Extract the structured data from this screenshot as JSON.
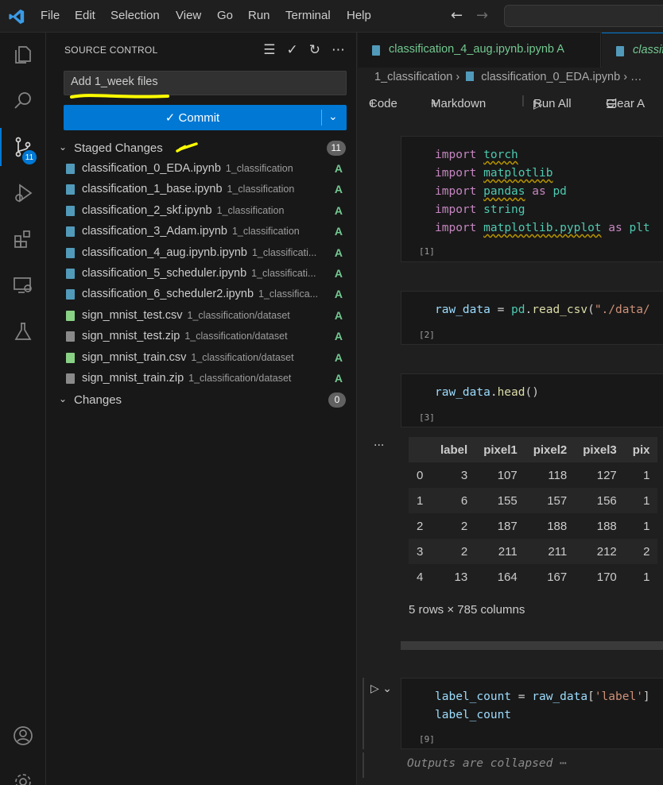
{
  "menu": [
    "File",
    "Edit",
    "Selection",
    "View",
    "Go",
    "Run",
    "Terminal",
    "Help"
  ],
  "activity": {
    "badge": "11"
  },
  "sidebar": {
    "title": "SOURCE CONTROL",
    "commit_message": "Add 1_week files",
    "commit_label": "Commit",
    "staged": {
      "title": "Staged Changes",
      "count": "11"
    },
    "changes": {
      "title": "Changes",
      "count": "0"
    },
    "files": [
      {
        "name": "classification_0_EDA.ipynb",
        "dir": "1_classification",
        "status": "A",
        "kind": "notebook"
      },
      {
        "name": "classification_1_base.ipynb",
        "dir": "1_classification",
        "status": "A",
        "kind": "notebook"
      },
      {
        "name": "classification_2_skf.ipynb",
        "dir": "1_classification",
        "status": "A",
        "kind": "notebook"
      },
      {
        "name": "classification_3_Adam.ipynb",
        "dir": "1_classification",
        "status": "A",
        "kind": "notebook"
      },
      {
        "name": "classification_4_aug.ipynb.ipynb",
        "dir": "1_classificati...",
        "status": "A",
        "kind": "notebook"
      },
      {
        "name": "classification_5_scheduler.ipynb",
        "dir": "1_classificati...",
        "status": "A",
        "kind": "notebook"
      },
      {
        "name": "classification_6_scheduler2.ipynb",
        "dir": "1_classifica...",
        "status": "A",
        "kind": "notebook"
      },
      {
        "name": "sign_mnist_test.csv",
        "dir": "1_classification/dataset",
        "status": "A",
        "kind": "csv"
      },
      {
        "name": "sign_mnist_test.zip",
        "dir": "1_classification/dataset",
        "status": "A",
        "kind": "zip"
      },
      {
        "name": "sign_mnist_train.csv",
        "dir": "1_classification/dataset",
        "status": "A",
        "kind": "csv"
      },
      {
        "name": "sign_mnist_train.zip",
        "dir": "1_classification/dataset",
        "status": "A",
        "kind": "zip"
      }
    ]
  },
  "editor": {
    "tabs": [
      {
        "label": "classification_4_aug.ipynb.ipynb",
        "status": "A"
      },
      {
        "label": "classifi"
      }
    ],
    "breadcrumb": {
      "folder": "1_classification",
      "file": "classification_0_EDA.ipynb"
    },
    "toolbar": {
      "code": "Code",
      "markdown": "Markdown",
      "run_all": "Run All",
      "clear": "Clear A"
    },
    "cells": [
      {
        "exec": "[1]"
      },
      {
        "exec": "[2]"
      },
      {
        "exec": "[3]"
      },
      {
        "exec": "[9]"
      }
    ],
    "dataframe": {
      "columns": [
        "",
        "label",
        "pixel1",
        "pixel2",
        "pixel3",
        "pix"
      ],
      "rows": [
        [
          "0",
          "3",
          "107",
          "118",
          "127",
          "1"
        ],
        [
          "1",
          "6",
          "155",
          "157",
          "156",
          "1"
        ],
        [
          "2",
          "2",
          "187",
          "188",
          "188",
          "1"
        ],
        [
          "3",
          "2",
          "211",
          "211",
          "212",
          "2"
        ],
        [
          "4",
          "13",
          "164",
          "167",
          "170",
          "1"
        ]
      ],
      "summary": "5 rows × 785 columns"
    },
    "collapsed_text": "Outputs are collapsed ⋯",
    "more": "..."
  },
  "colors": {
    "accent": "#0078d4",
    "added": "#73c991",
    "highlight": "#ffff00"
  }
}
